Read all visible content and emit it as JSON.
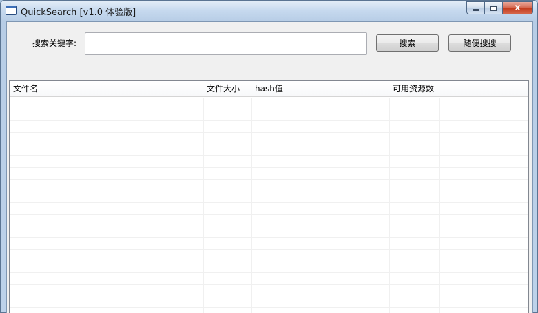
{
  "window": {
    "title": "QuickSearch [v1.0 体验版]",
    "accent_color": "#c4d9ef",
    "close_color": "#c2391b",
    "controls": {
      "minimize_icon": "minimize-icon",
      "maximize_icon": "maximize-icon",
      "close_glyph": "x"
    }
  },
  "search": {
    "label": "搜索关键字:",
    "value": "",
    "placeholder": "",
    "search_button": "搜索",
    "random_button": "随便搜搜"
  },
  "table": {
    "columns": [
      "文件名",
      "文件大小",
      "hash值",
      "可用资源数",
      ""
    ],
    "rows": []
  }
}
